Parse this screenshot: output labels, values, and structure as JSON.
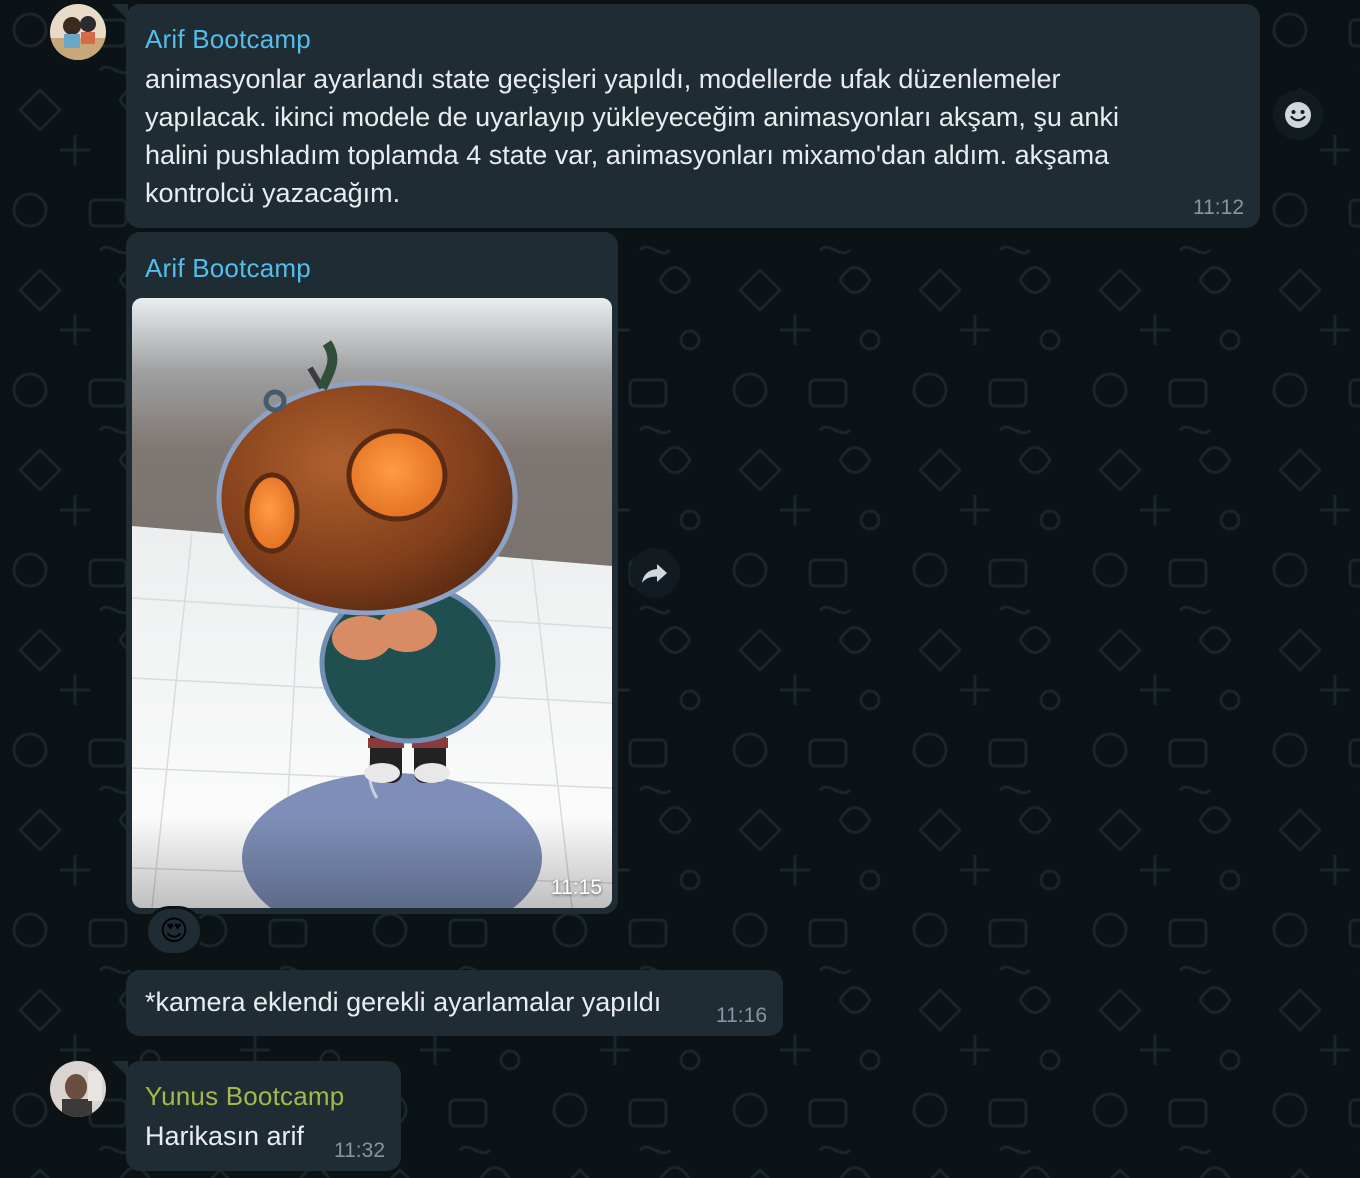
{
  "messages": [
    {
      "sender": "Arif Bootcamp",
      "text_lines": [
        "animasyonlar ayarlandı state geçişleri yapıldı, modellerde ufak düzenlemeler",
        "yapılacak. ikinci modele de uyarlayıp yükleyeceğim animasyonları akşam, şu anki",
        "halini pushladım toplamda 4 state var, animasyonları mixamo'dan aldım. akşama",
        "kontrolcü yazacağım."
      ],
      "time": "11:12"
    },
    {
      "sender": "Arif Bootcamp",
      "media": "pumpkin-character-3d-image",
      "time": "11:15",
      "reaction": "😍"
    },
    {
      "text": "*kamera eklendi gerekli ayarlamalar yapıldı",
      "time": "11:16"
    },
    {
      "sender": "Yunus Bootcamp",
      "text": "Harikasın arif",
      "time": "11:32"
    }
  ],
  "icons": {
    "react_button": "smiley-icon",
    "forward_button": "forward-arrow-icon"
  },
  "colors": {
    "background": "#0c1317",
    "bubble": "#1f2c34",
    "arif_name": "#53bdeb",
    "yunus_name": "#a7b84a",
    "text": "#e9edef",
    "meta": "#8696a0"
  }
}
